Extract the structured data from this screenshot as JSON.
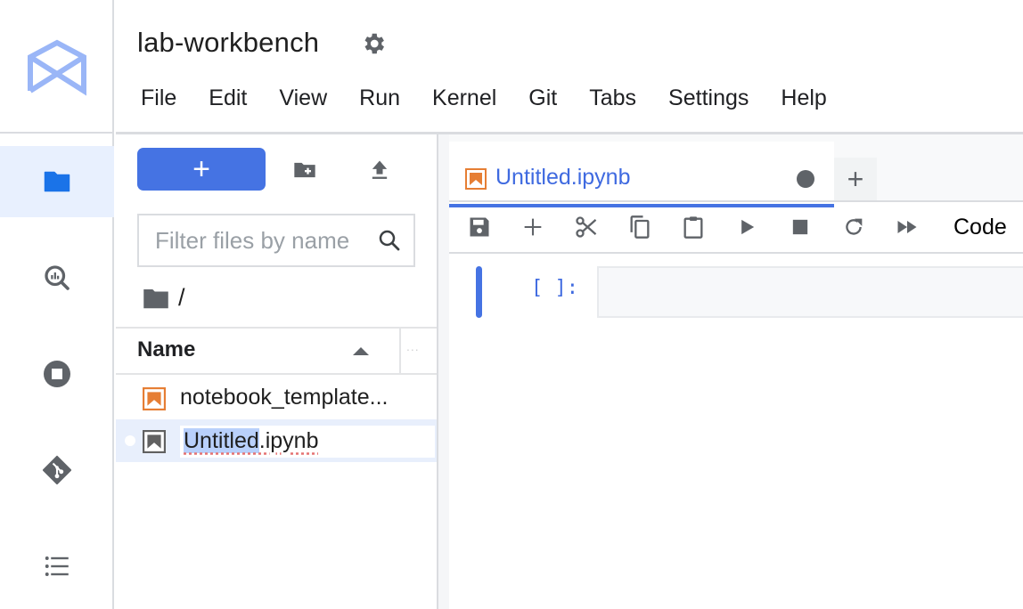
{
  "header": {
    "title": "lab-workbench",
    "menu": [
      "File",
      "Edit",
      "View",
      "Run",
      "Kernel",
      "Git",
      "Tabs",
      "Settings",
      "Help"
    ]
  },
  "activity_bar": {
    "items": [
      {
        "name": "file-browser",
        "icon": "folder-icon",
        "active": true
      },
      {
        "name": "bigquery-search",
        "icon": "analytics-search-icon",
        "active": false
      },
      {
        "name": "running-kernels",
        "icon": "stop-circle-icon",
        "active": false
      },
      {
        "name": "git",
        "icon": "git-icon",
        "active": false
      },
      {
        "name": "table-of-contents",
        "icon": "list-icon",
        "active": false
      }
    ]
  },
  "file_browser": {
    "new_label": "+",
    "filter": {
      "value": "",
      "placeholder": "Filter files by name"
    },
    "breadcrumb": "/",
    "column_header": "Name",
    "column_more": "...",
    "files": [
      {
        "name": "notebook_template...",
        "type": "notebook",
        "icon_color": "#e67e34",
        "selected": false,
        "running": false
      },
      {
        "name": "Untitled.ipynb",
        "type": "notebook",
        "icon_color": "#616161",
        "selected": true,
        "running": true,
        "renaming": true,
        "rename_selected": "Untitled",
        "rename_rest": ".ipynb"
      }
    ]
  },
  "editor": {
    "tabs": [
      {
        "label": "Untitled.ipynb",
        "active": true,
        "dirty": true
      }
    ],
    "add_tab_label": "+",
    "toolbar": {
      "buttons": [
        "save",
        "insert-cell",
        "cut",
        "copy",
        "paste",
        "run",
        "interrupt",
        "restart",
        "run-all"
      ],
      "cell_type": "Code"
    },
    "cells": [
      {
        "prompt": "[ ]:",
        "source": ""
      }
    ]
  },
  "colors": {
    "accent": "#4573e3",
    "notebook_orange": "#e67e34",
    "icon_gray": "#616161"
  }
}
